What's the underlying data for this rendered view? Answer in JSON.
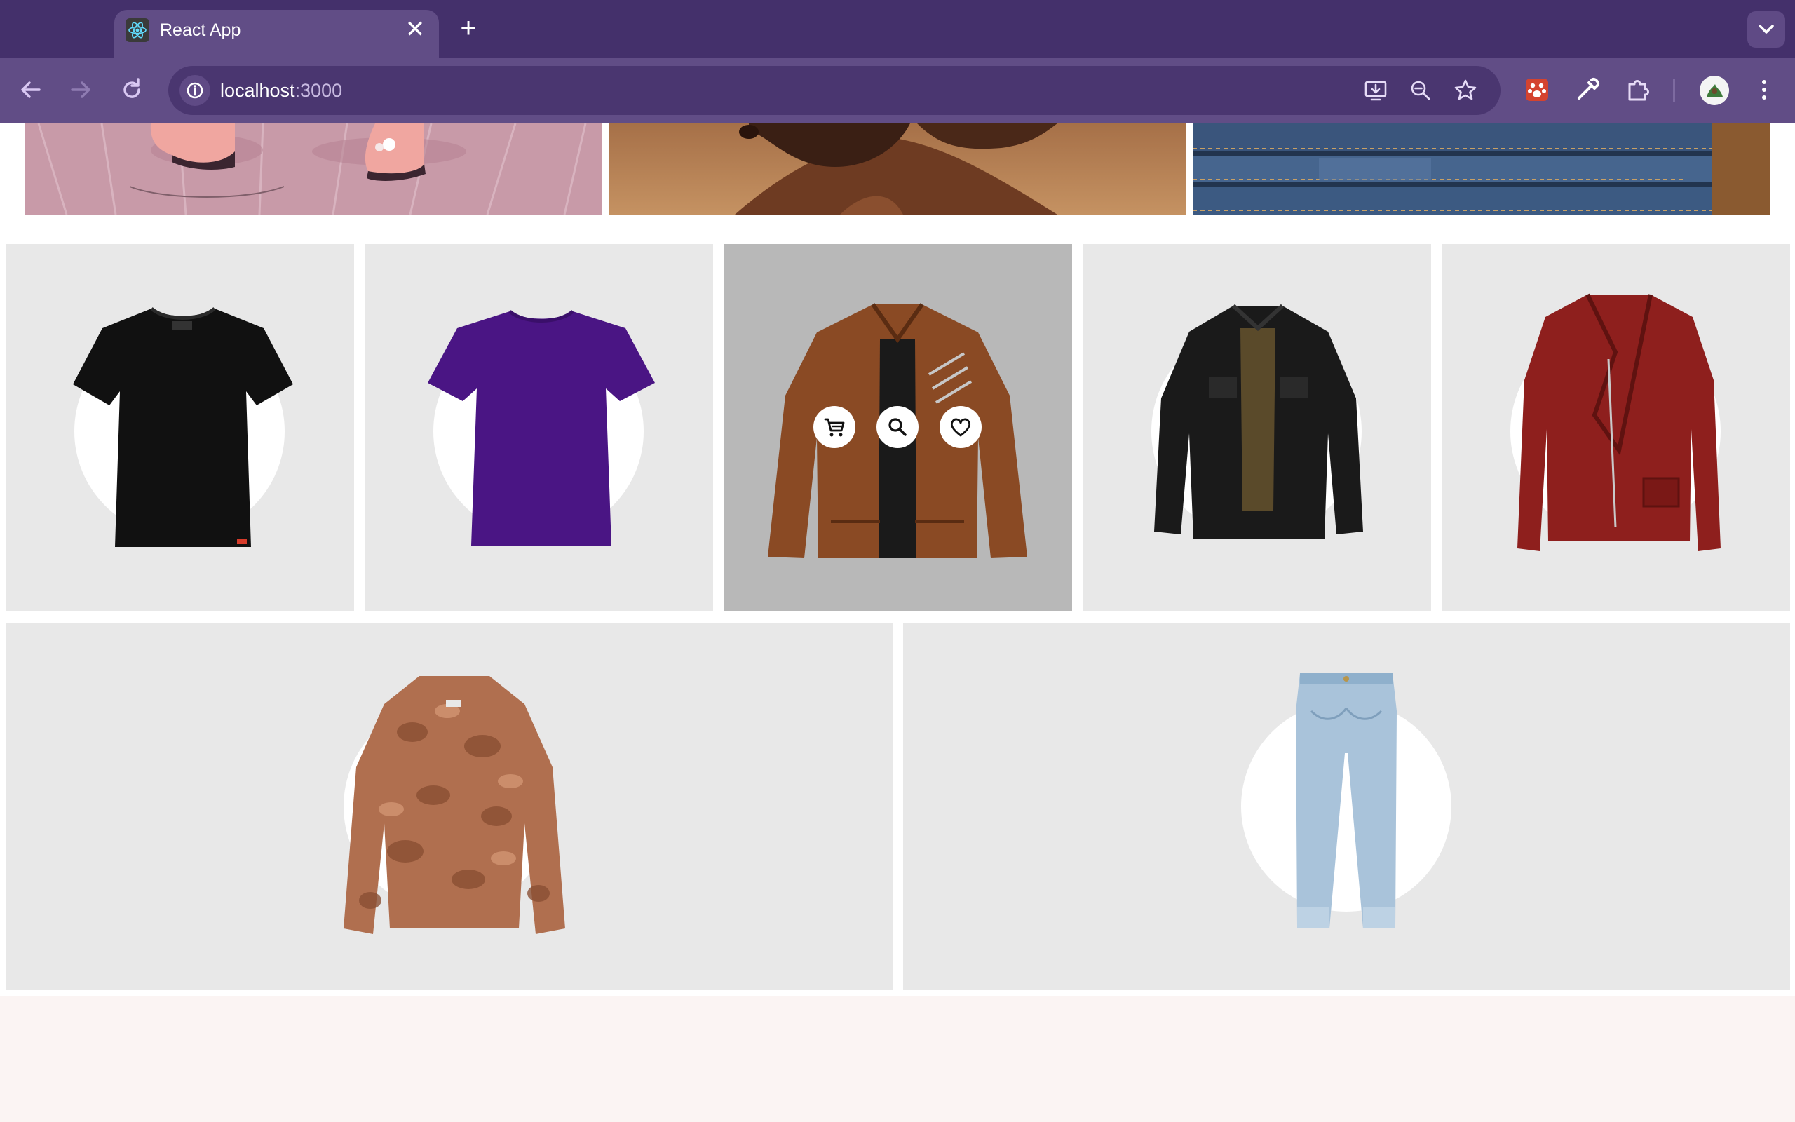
{
  "browser": {
    "tab_title": "React App",
    "tab_close_glyph": "✕",
    "new_tab_glyph": "+",
    "url_host": "localhost",
    "url_port": ":3000"
  },
  "icons": {
    "favicon": "react-logo-icon",
    "back": "arrow-left-icon",
    "forward": "arrow-right-icon",
    "reload": "reload-icon",
    "site_info": "info-icon",
    "install": "install-app-icon",
    "zoom": "zoom-out-icon",
    "bookmark": "star-icon",
    "extensions": [
      "extension-paw-icon",
      "color-picker-icon",
      "puzzle-icon"
    ],
    "menu": "kebab-menu-icon",
    "tab_search": "chevron-down-icon"
  },
  "colors": {
    "tabstrip": "#44306b",
    "toolbar": "#614d86",
    "omnibox": "#4a3670",
    "card_bg": "#e8e8e8",
    "card_hover_bg": "#b8b8b8",
    "footer_bg": "#fbf4f3"
  },
  "banners": [
    {
      "name": "shoes-banner",
      "theme": "pink boots illustration"
    },
    {
      "name": "brown-banner",
      "theme": "brown abstract"
    },
    {
      "name": "jeans-banner",
      "theme": "folded denim jeans"
    }
  ],
  "products": [
    {
      "name": "black-tshirt",
      "item": "t-shirt",
      "color": "#111111"
    },
    {
      "name": "purple-tshirt",
      "item": "t-shirt",
      "color": "#4a1584"
    },
    {
      "name": "brown-leather-jacket",
      "item": "leather jacket",
      "color": "#8a4a24",
      "hovered": true
    },
    {
      "name": "black-jacket",
      "item": "jacket",
      "color": "#1a1a1a"
    },
    {
      "name": "red-leather-jacket",
      "item": "leather jacket",
      "color": "#8e1f1d"
    },
    {
      "name": "fur-jacket",
      "item": "fur coat",
      "color": "#b06f4f"
    },
    {
      "name": "light-jeans",
      "item": "jeans",
      "color": "#a9c3da"
    }
  ],
  "card_actions": [
    "cart-icon",
    "search-icon",
    "heart-icon"
  ]
}
